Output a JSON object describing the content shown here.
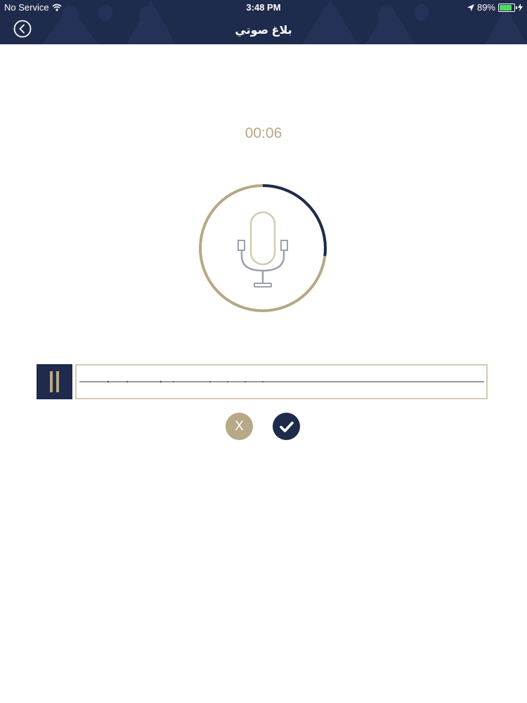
{
  "status_bar": {
    "carrier": "No Service",
    "time": "3:48 PM",
    "battery_percent": "89%",
    "battery_level": 0.89,
    "icons": [
      "wifi-icon",
      "location-arrow-icon",
      "battery-icon",
      "charging-bolt-icon"
    ]
  },
  "nav": {
    "title": "بلاغ صوتي",
    "back_icon": "chevron-left-circle-icon"
  },
  "recorder": {
    "elapsed": "00:06",
    "progress": 0.27,
    "mic_icon": "microphone-icon"
  },
  "player": {
    "pause_icon": "pause-icon"
  },
  "actions": {
    "cancel_label": "X",
    "confirm_icon": "checkmark-icon"
  },
  "colors": {
    "navy": "#1f2b4d",
    "gold": "#b7a886",
    "light_gold": "#d5cab1",
    "mic_gray": "#9aa0ad"
  }
}
